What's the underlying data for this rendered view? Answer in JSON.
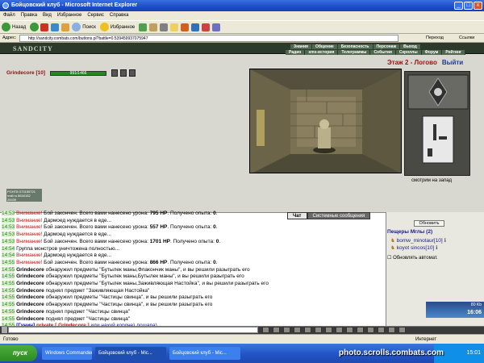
{
  "window": {
    "title": "Бойцовский клуб - Microsoft Internet Explorer",
    "btn_min": "_",
    "btn_max": "□",
    "btn_close": "x"
  },
  "menu": [
    "Файл",
    "Правка",
    "Вид",
    "Избранное",
    "Сервис",
    "Справка"
  ],
  "toolbar": {
    "back": "Назад",
    "search": "Поиск",
    "favorites": "Избранное"
  },
  "address": {
    "label": "Адрес:",
    "url": "http://sandcity.combats.com/buttons.pl?battle=0.539459937075947",
    "go": "Переход",
    "links": "Ссылки"
  },
  "site": {
    "logo": "SANDCITY",
    "nav_top": [
      "Знания",
      "Общение",
      "Безопасность",
      "Персонаж",
      "Выход"
    ],
    "nav_bottom": [
      "Радио",
      "sms-история",
      "Телеграммы",
      "События",
      "Скроллы",
      "Форум",
      "Рейтинг"
    ]
  },
  "location": {
    "title": "Этаж 2 - Логово",
    "exit": "Выйти",
    "look": "смотрим на запад"
  },
  "player": {
    "name": "Grindecore",
    "level": "[10]",
    "hp": "991/1466"
  },
  "counter": {
    "line1": "PGHTВ 073155721",
    "line2": "mail.ru 8644162",
    "line3": "28439"
  },
  "chat_tabs": [
    "Чат",
    "Системные сообщения"
  ],
  "chat": [
    {
      "time": "14:53",
      "warn": "Внимание!",
      "text": " Бой закончен. Всего вами нанесено урона: ",
      "num": "795 HP",
      "rest": ". Получено опыта: ",
      "exp": "0",
      "end": "."
    },
    {
      "time": "14:53",
      "warn": "Внимание!",
      "text": " Дармоед нуждается в еде..."
    },
    {
      "time": "14:53",
      "warn": "Внимание!",
      "text": " Бой закончен. Всего вами нанесено урона: ",
      "num": "557 HP",
      "rest": ". Получено опыта: ",
      "exp": "0",
      "end": "."
    },
    {
      "time": "14:53",
      "warn": "Внимание!",
      "text": " Дармоед нуждается в еде..."
    },
    {
      "time": "14:53",
      "warn": "Внимание!",
      "text": " Бой закончен. Всего вами нанесено урона: ",
      "num": "1701 HP",
      "rest": ". Получено опыта: ",
      "exp": "0",
      "end": "."
    },
    {
      "time": "14:54",
      "plain": "Группа монстров уничтожена полностью..."
    },
    {
      "time": "14:54",
      "warn": "Внимание!",
      "text": " Дармоед нуждается в еде..."
    },
    {
      "time": "14:55",
      "warn": "Внимание!",
      "text": " Бой закончен. Всего вами нанесено урона: ",
      "num": "866 HP",
      "rest": ". Получено опыта: ",
      "exp": "0",
      "end": "."
    },
    {
      "time": "14:55",
      "who": "Grindecore",
      "plain": " обнаружил предметы \"Бутылек маны,Флакончик маны\", и вы решили разыграть его"
    },
    {
      "time": "14:55",
      "who": "Grindecore",
      "plain": " обнаружил предметы \"Бутылек маны,Бутылек маны\", и вы решили разыграть его"
    },
    {
      "time": "14:55",
      "who": "Grindecore",
      "plain": " обнаружил предметы \"Бутылек маны,Заживляющая Настойка\", и вы решили разыграть его"
    },
    {
      "time": "14:55",
      "who": "Grindecore",
      "plain": " поднял предмет \"Заживляющая Настойка\""
    },
    {
      "time": "14:55",
      "who": "Grindecore",
      "plain": " обнаружил предметы \"Частицы свинца\", и вы решили разыграть его"
    },
    {
      "time": "14:55",
      "who": "Grindecore",
      "plain": " обнаружил предметы \"Частицы свинца\", и вы решили разыграть его"
    },
    {
      "time": "14:55",
      "who": "Grindecore",
      "plain": " поднял предмет \"Частицы свинца\""
    },
    {
      "time": "14:55",
      "who": "Grindecore",
      "plain": " поднял предмет \"Частицы свинца\""
    }
  ],
  "private": {
    "time": "14:55",
    "from": "[Гунич]",
    "label": "private [ Grindecore ]",
    "msg": " иди нахуй короче) лошара)"
  },
  "side": {
    "refresh": "Обновить",
    "cave": "Пещеры Мглы (2)",
    "members": [
      {
        "name": "bomw_minotaur",
        "lvl": "[10]"
      },
      {
        "name": "koyot sincos",
        "lvl": "[10]"
      }
    ],
    "auto": "Обновлять автомат."
  },
  "net_label": "80 Kb",
  "clock": "16:06",
  "status": {
    "ready": "Готово",
    "zone": "Интернет"
  },
  "taskbar": {
    "start": "пуск",
    "tasks": [
      "Windows Commander",
      "Бойцовский клуб - Mic...",
      "Бойцовский клуб - Mic..."
    ],
    "clock": "15:01"
  },
  "watermark": "photo.scrolls.combats.com",
  "colors": {
    "accent_red": "#d01010",
    "chat_time_green": "#1a8a1a",
    "nav_green": "#506850",
    "xp_blue": "#1e48b0"
  }
}
